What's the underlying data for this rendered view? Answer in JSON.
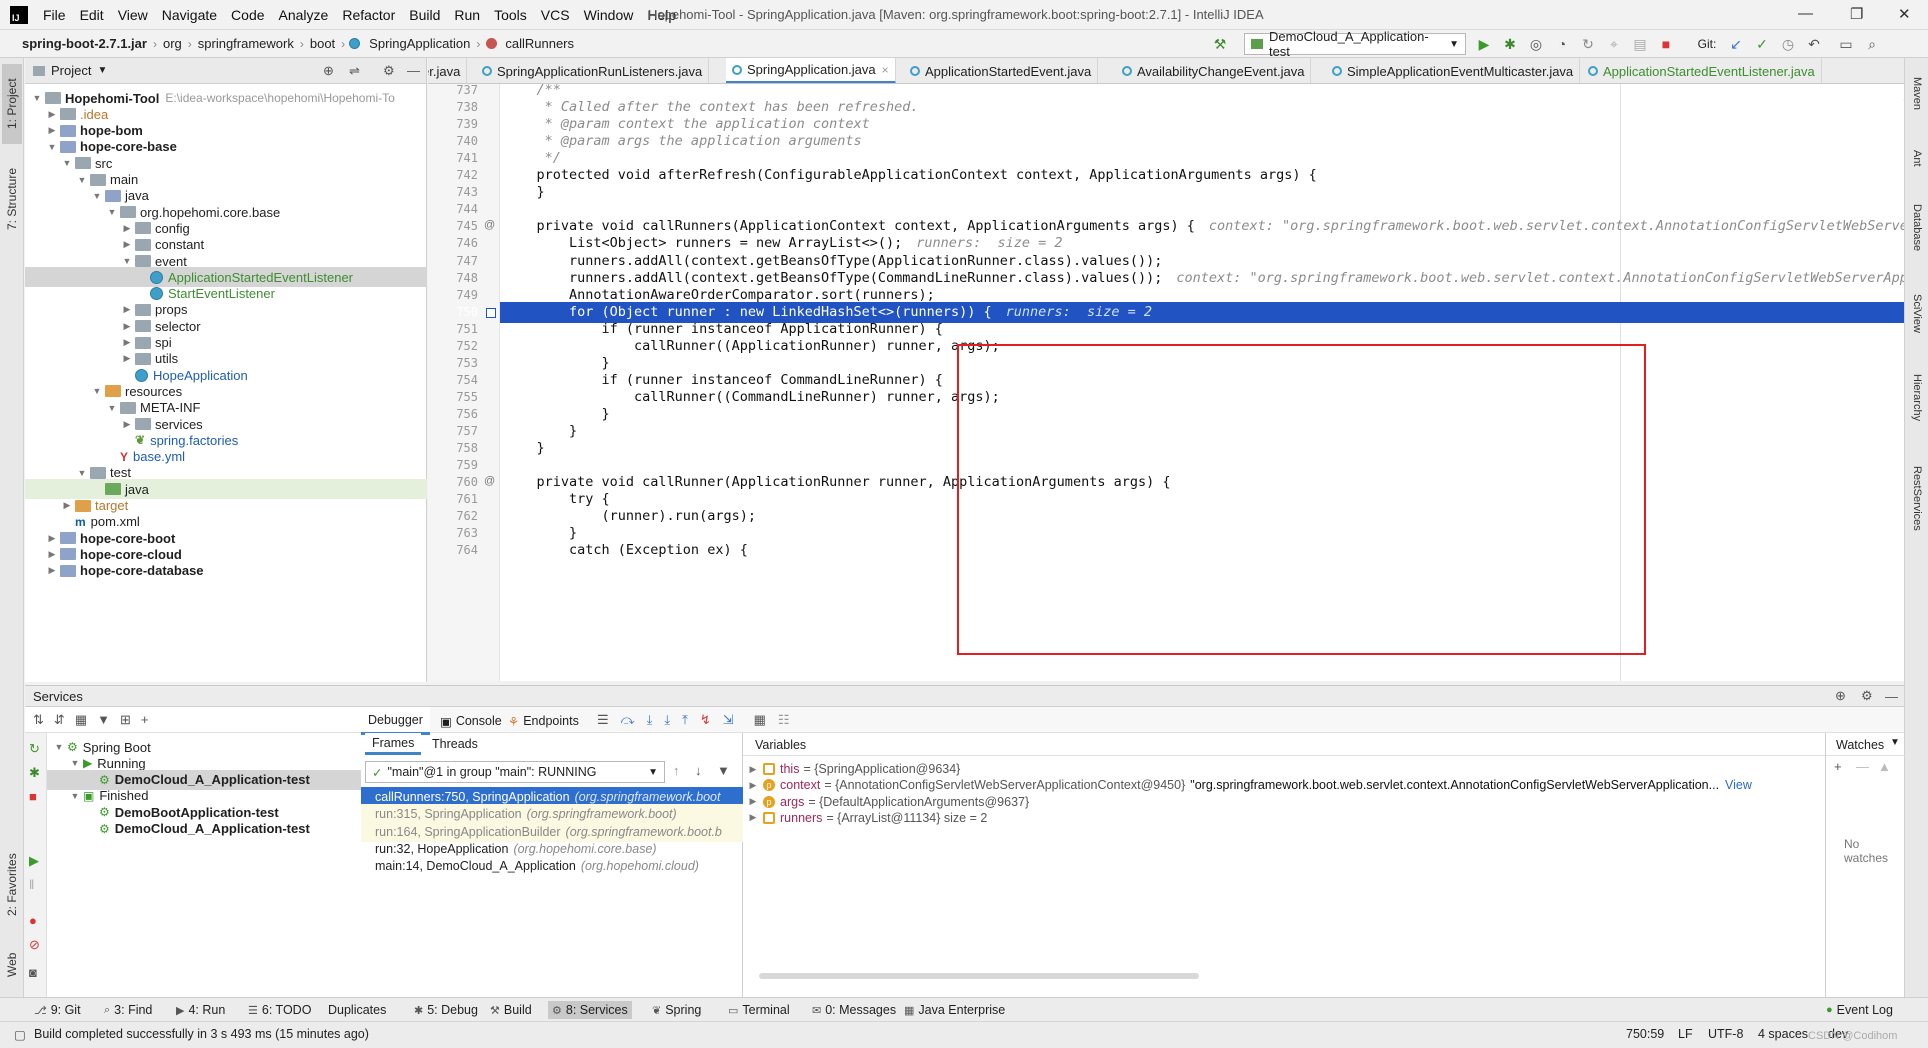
{
  "app": {
    "menu": [
      "File",
      "Edit",
      "View",
      "Navigate",
      "Code",
      "Analyze",
      "Refactor",
      "Build",
      "Run",
      "Tools",
      "VCS",
      "Window",
      "Help"
    ],
    "window_title": "Hopehomi-Tool - SpringApplication.java [Maven: org.springframework.boot:spring-boot:2.7.1] - IntelliJ IDEA"
  },
  "breadcrumb": [
    "spring-boot-2.7.1.jar",
    "org",
    "springframework",
    "boot",
    "SpringApplication",
    "callRunners"
  ],
  "toolbar": {
    "run_config": "DemoCloud_A_Application-test",
    "git_label": "Git:"
  },
  "left_tools": [
    "1: Project",
    "7: Structure",
    "2: Favorites",
    "Web"
  ],
  "right_tools": [
    "Maven",
    "Ant",
    "Database",
    "SciView",
    "Hierarchy",
    "RestServices"
  ],
  "project": {
    "header": "Project",
    "tree": [
      {
        "label": "Hopehomi-Tool",
        "suffix": "E:\\idea-workspace\\hopehomi\\Hopehomi-To",
        "depth": 0,
        "arrow": "▼",
        "icon": "folder",
        "bold": true
      },
      {
        "label": ".idea",
        "depth": 1,
        "arrow": "▶",
        "icon": "folder",
        "color": "orange"
      },
      {
        "label": "hope-bom",
        "depth": 1,
        "arrow": "▶",
        "icon": "module",
        "bold": true
      },
      {
        "label": "hope-core-base",
        "depth": 1,
        "arrow": "▼",
        "icon": "module",
        "bold": true
      },
      {
        "label": "src",
        "depth": 2,
        "arrow": "▼",
        "icon": "folder"
      },
      {
        "label": "main",
        "depth": 3,
        "arrow": "▼",
        "icon": "folder"
      },
      {
        "label": "java",
        "depth": 4,
        "arrow": "▼",
        "icon": "src"
      },
      {
        "label": "org.hopehomi.core.base",
        "depth": 5,
        "arrow": "▼",
        "icon": "folder"
      },
      {
        "label": "config",
        "depth": 6,
        "arrow": "▶",
        "icon": "folder"
      },
      {
        "label": "constant",
        "depth": 6,
        "arrow": "▶",
        "icon": "folder"
      },
      {
        "label": "event",
        "depth": 6,
        "arrow": "▼",
        "icon": "folder"
      },
      {
        "label": "ApplicationStartedEventListener",
        "depth": 7,
        "arrow": "",
        "icon": "class",
        "color": "green",
        "selected": true
      },
      {
        "label": "StartEventListener",
        "depth": 7,
        "arrow": "",
        "icon": "class",
        "color": "green"
      },
      {
        "label": "props",
        "depth": 6,
        "arrow": "▶",
        "icon": "folder"
      },
      {
        "label": "selector",
        "depth": 6,
        "arrow": "▶",
        "icon": "folder"
      },
      {
        "label": "spi",
        "depth": 6,
        "arrow": "▶",
        "icon": "folder"
      },
      {
        "label": "utils",
        "depth": 6,
        "arrow": "▶",
        "icon": "folder"
      },
      {
        "label": "HopeApplication",
        "depth": 6,
        "arrow": "",
        "icon": "class",
        "color": "blue"
      },
      {
        "label": "resources",
        "depth": 4,
        "arrow": "▼",
        "icon": "res"
      },
      {
        "label": "META-INF",
        "depth": 5,
        "arrow": "▼",
        "icon": "folder"
      },
      {
        "label": "services",
        "depth": 6,
        "arrow": "▶",
        "icon": "folder"
      },
      {
        "label": "spring.factories",
        "depth": 6,
        "arrow": "",
        "icon": "leaf",
        "color": "blue"
      },
      {
        "label": "base.yml",
        "depth": 5,
        "arrow": "",
        "icon": "yml",
        "color": "blue"
      },
      {
        "label": "test",
        "depth": 3,
        "arrow": "▼",
        "icon": "folder"
      },
      {
        "label": "java",
        "depth": 4,
        "arrow": "",
        "icon": "test",
        "testbg": true
      },
      {
        "label": "target",
        "depth": 2,
        "arrow": "▶",
        "icon": "target",
        "color": "orange"
      },
      {
        "label": "pom.xml",
        "depth": 2,
        "arrow": "",
        "icon": "maven"
      },
      {
        "label": "hope-core-boot",
        "depth": 1,
        "arrow": "▶",
        "icon": "module",
        "bold": true
      },
      {
        "label": "hope-core-cloud",
        "depth": 1,
        "arrow": "▶",
        "icon": "module",
        "bold": true
      },
      {
        "label": "hope-core-database",
        "depth": 1,
        "arrow": "▶",
        "icon": "module",
        "bold": true
      }
    ]
  },
  "editor_tabs": [
    {
      "label": "er.java"
    },
    {
      "label": "SpringApplicationRunListeners.java"
    },
    {
      "label": "SpringApplication.java",
      "active": true
    },
    {
      "label": "ApplicationStartedEvent.java"
    },
    {
      "label": "AvailabilityChangeEvent.java"
    },
    {
      "label": "SimpleApplicationEventMulticaster.java"
    },
    {
      "label": "ApplicationStartedEventListener.java",
      "green": true
    }
  ],
  "code": [
    {
      "n": "737",
      "t": "    /**",
      "k": "cmt"
    },
    {
      "n": "738",
      "t": "     * Called after the context has been refreshed.",
      "k": "cmt"
    },
    {
      "n": "739",
      "t": "     * @param context the application context",
      "k": "cmt"
    },
    {
      "n": "740",
      "t": "     * @param args the application arguments",
      "k": "cmt"
    },
    {
      "n": "741",
      "t": "     */",
      "k": "cmt"
    },
    {
      "n": "742",
      "t": "    protected void afterRefresh(ConfigurableApplicationContext context, ApplicationArguments args) {"
    },
    {
      "n": "743",
      "t": "    }"
    },
    {
      "n": "744",
      "t": ""
    },
    {
      "n": "745",
      "t": "    private void callRunners(ApplicationContext context, ApplicationArguments args) {",
      "hint": "context: \"org.springframework.boot.web.servlet.context.AnnotationConfigServletWebServerAp"
    },
    {
      "n": "746",
      "t": "        List<Object> runners = new ArrayList<>();",
      "hint": "runners:  size = 2"
    },
    {
      "n": "747",
      "t": "        runners.addAll(context.getBeansOfType(ApplicationRunner.class).values());"
    },
    {
      "n": "748",
      "t": "        runners.addAll(context.getBeansOfType(CommandLineRunner.class).values());",
      "hint": "context: \"org.springframework.boot.web.servlet.context.AnnotationConfigServletWebServerApplic"
    },
    {
      "n": "749",
      "t": "        AnnotationAwareOrderComparator.sort(runners);"
    },
    {
      "n": "750",
      "t": "        for (Object runner : new LinkedHashSet<>(runners)) {",
      "hint": "runners:  size = 2",
      "current": true
    },
    {
      "n": "751",
      "t": "            if (runner instanceof ApplicationRunner) {"
    },
    {
      "n": "752",
      "t": "                callRunner((ApplicationRunner) runner, args);"
    },
    {
      "n": "753",
      "t": "            }"
    },
    {
      "n": "754",
      "t": "            if (runner instanceof CommandLineRunner) {"
    },
    {
      "n": "755",
      "t": "                callRunner((CommandLineRunner) runner, args);"
    },
    {
      "n": "756",
      "t": "            }"
    },
    {
      "n": "757",
      "t": "        }"
    },
    {
      "n": "758",
      "t": "    }"
    },
    {
      "n": "759",
      "t": ""
    },
    {
      "n": "760",
      "t": "    private void callRunner(ApplicationRunner runner, ApplicationArguments args) {"
    },
    {
      "n": "761",
      "t": "        try {"
    },
    {
      "n": "762",
      "t": "            (runner).run(args);"
    },
    {
      "n": "763",
      "t": "        }"
    },
    {
      "n": "764",
      "t": "        catch (Exception ex) {"
    }
  ],
  "services": {
    "title": "Services",
    "tree": [
      {
        "label": "Spring Boot",
        "depth": 0,
        "arrow": "▼"
      },
      {
        "label": "Running",
        "depth": 1,
        "arrow": "▼"
      },
      {
        "label": "DemoCloud_A_Application-test",
        "depth": 2,
        "arrow": "",
        "bold": true,
        "selected": true
      },
      {
        "label": "Finished",
        "depth": 1,
        "arrow": "▼"
      },
      {
        "label": "DemoBootApplication-test",
        "depth": 2,
        "arrow": "",
        "bold": true
      },
      {
        "label": "DemoCloud_A_Application-test",
        "depth": 2,
        "arrow": "",
        "bold": true
      }
    ],
    "debug_tabs": [
      "Debugger",
      "Console",
      "Endpoints"
    ],
    "sub_tabs": [
      "Frames",
      "Threads"
    ],
    "thread_select": "\"main\"@1 in group \"main\": RUNNING",
    "frames": [
      {
        "m": "callRunners:750, SpringApplication",
        "p": "(org.springframework.boot",
        "sel": true
      },
      {
        "m": "run:315, SpringApplication",
        "p": "(org.springframework.boot)",
        "yel": true
      },
      {
        "m": "run:164, SpringApplicationBuilder",
        "p": "(org.springframework.boot.b",
        "yel": true
      },
      {
        "m": "run:32, HopeApplication",
        "p": "(org.hopehomi.core.base)"
      },
      {
        "m": "main:14, DemoCloud_A_Application",
        "p": "(org.hopehomi.cloud)"
      }
    ],
    "variables_label": "Variables",
    "variables": [
      {
        "name": "this",
        "val": "= {SpringApplication@9634}",
        "icon": "sq"
      },
      {
        "name": "context",
        "val": "= {AnnotationConfigServletWebServerApplicationContext@9450}",
        "extra": "\"org.springframework.boot.web.servlet.context.AnnotationConfigServletWebServerApplication...",
        "link": "View",
        "icon": "p"
      },
      {
        "name": "args",
        "val": "= {DefaultApplicationArguments@9637}",
        "icon": "p"
      },
      {
        "name": "runners",
        "val": "= {ArrayList@11134}  size = 2",
        "icon": "sq"
      }
    ],
    "watches_label": "Watches",
    "no_watches": "No watches"
  },
  "bottom_tabs": [
    {
      "label": "9: Git"
    },
    {
      "label": "3: Find"
    },
    {
      "label": "4: Run"
    },
    {
      "label": "6: TODO"
    },
    {
      "label": "Duplicates"
    },
    {
      "label": "5: Debug"
    },
    {
      "label": "Build"
    },
    {
      "label": "8: Services",
      "active": true
    },
    {
      "label": "Spring"
    },
    {
      "label": "Terminal"
    },
    {
      "label": "0: Messages"
    },
    {
      "label": "Java Enterprise"
    },
    {
      "label": "Event Log"
    }
  ],
  "status": {
    "message": "Build completed successfully in 3 s 493 ms (15 minutes ago)",
    "position": "750:59",
    "line_sep": "LF",
    "encoding": "UTF-8",
    "indent": "4 spaces",
    "branch": "dev",
    "watermark": "CSDN @Codihom"
  }
}
